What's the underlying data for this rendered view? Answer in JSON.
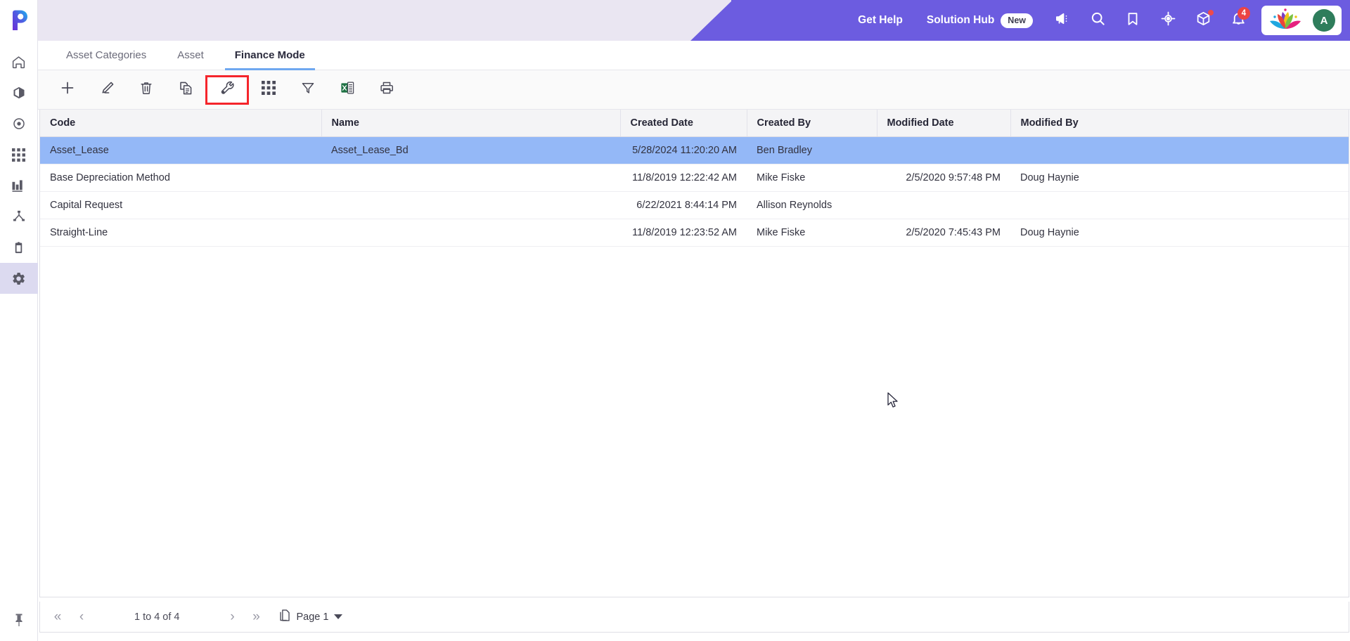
{
  "topbar": {
    "get_help": "Get Help",
    "solution_hub": "Solution Hub",
    "new_badge": "New",
    "notification_count": "4",
    "avatar_initial": "A",
    "purple": "#6c5ce0",
    "icons": [
      "megaphone-icon",
      "search-icon",
      "bookmark-icon",
      "target-icon",
      "cube-icon",
      "bell-icon"
    ]
  },
  "sidebar": {
    "items": [
      {
        "name": "home-icon",
        "active": false
      },
      {
        "name": "cube-icon",
        "active": false
      },
      {
        "name": "target-icon",
        "active": false
      },
      {
        "name": "apps-grid-icon",
        "active": false
      },
      {
        "name": "bar-chart-icon",
        "active": false
      },
      {
        "name": "hierarchy-icon",
        "active": false
      },
      {
        "name": "clipboard-check-icon",
        "active": false
      },
      {
        "name": "settings-gear-icon",
        "active": true
      }
    ],
    "pin": "pin-icon"
  },
  "tabs": [
    {
      "label": "Asset Categories",
      "active": false
    },
    {
      "label": "Asset",
      "active": false
    },
    {
      "label": "Finance Mode",
      "active": true
    }
  ],
  "toolbar": {
    "buttons": [
      {
        "name": "add-button",
        "icon": "plus-icon",
        "highlighted": false
      },
      {
        "name": "edit-button",
        "icon": "pencil-icon",
        "highlighted": false
      },
      {
        "name": "delete-button",
        "icon": "trash-icon",
        "highlighted": false
      },
      {
        "name": "copy-button",
        "icon": "copy-icon",
        "highlighted": false
      },
      {
        "name": "configure-button",
        "icon": "wrench-icon",
        "highlighted": true
      },
      {
        "name": "columns-button",
        "icon": "grid-icon",
        "highlighted": false
      },
      {
        "name": "filter-button",
        "icon": "funnel-icon",
        "highlighted": false
      },
      {
        "name": "export-excel-button",
        "icon": "excel-icon",
        "highlighted": false
      },
      {
        "name": "print-button",
        "icon": "printer-icon",
        "highlighted": false
      }
    ],
    "highlight_color": "#f5252b"
  },
  "grid": {
    "columns": [
      "Code",
      "Name",
      "Created Date",
      "Created By",
      "Modified Date",
      "Modified By"
    ],
    "rows": [
      {
        "selected": true,
        "code": "Asset_Lease",
        "name": "Asset_Lease_Bd",
        "created_date": "5/28/2024 11:20:20 AM",
        "created_by": "Ben Bradley",
        "modified_date": "",
        "modified_by": ""
      },
      {
        "selected": false,
        "code": "Base Depreciation Method",
        "name": "",
        "created_date": "11/8/2019 12:22:42 AM",
        "created_by": "Mike Fiske",
        "modified_date": "2/5/2020 9:57:48 PM",
        "modified_by": "Doug Haynie"
      },
      {
        "selected": false,
        "code": "Capital Request",
        "name": "",
        "created_date": "6/22/2021 8:44:14 PM",
        "created_by": "Allison Reynolds",
        "modified_date": "",
        "modified_by": ""
      },
      {
        "selected": false,
        "code": "Straight-Line",
        "name": "",
        "created_date": "11/8/2019 12:23:52 AM",
        "created_by": "Mike Fiske",
        "modified_date": "2/5/2020 7:45:43 PM",
        "modified_by": "Doug Haynie"
      }
    ],
    "selected_row_color": "#94b8f7"
  },
  "pager": {
    "first": "«",
    "prev": "‹",
    "range": "1 to 4 of 4",
    "next": "›",
    "last": "»",
    "page_label": "Page 1",
    "page_icon": "pages-icon",
    "dropdown_icon": "caret-down-icon"
  }
}
